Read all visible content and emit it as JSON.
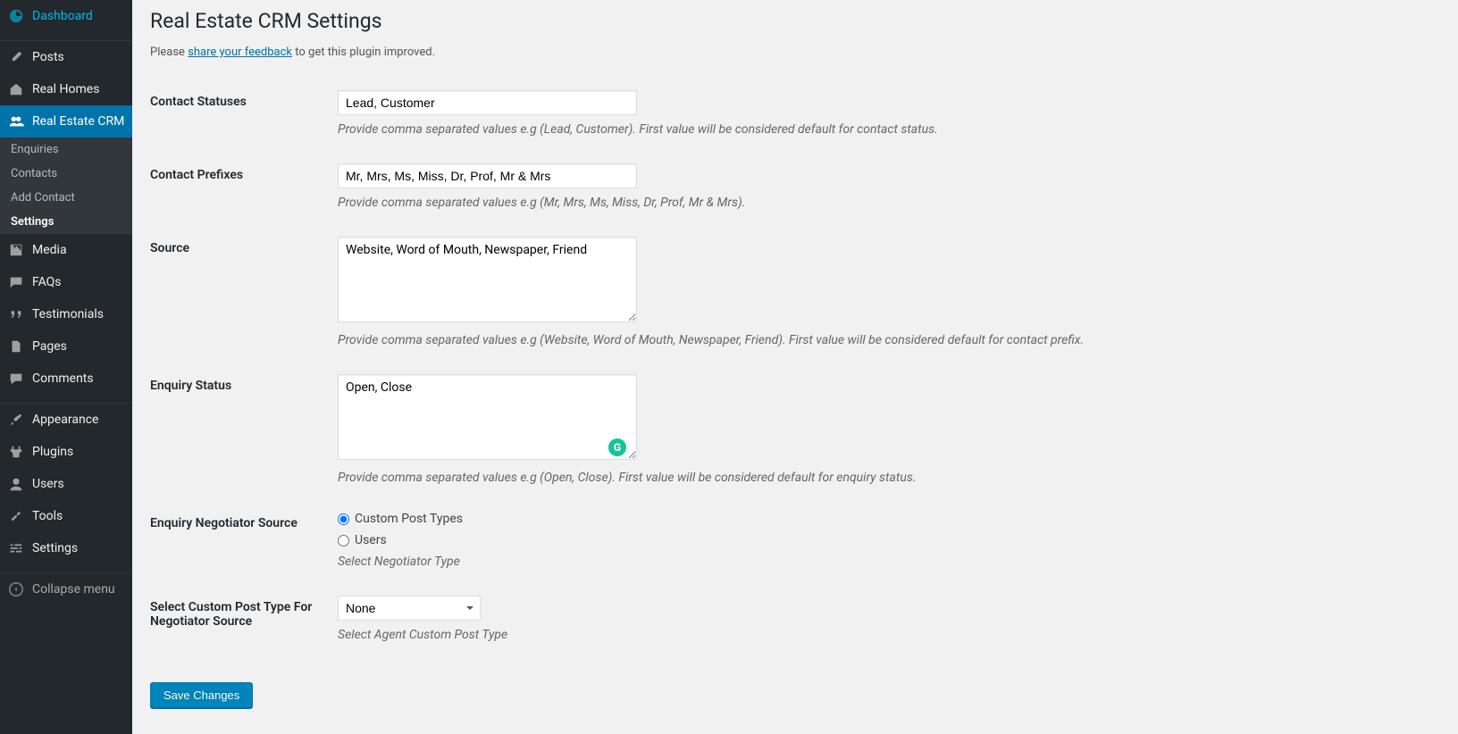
{
  "sidebar": {
    "items": [
      {
        "label": "Dashboard",
        "icon": "dashboard"
      },
      {
        "label": "Posts",
        "icon": "pin"
      },
      {
        "label": "Real Homes",
        "icon": "home"
      },
      {
        "label": "Real Estate CRM",
        "icon": "people",
        "active": true
      },
      {
        "label": "Media",
        "icon": "media"
      },
      {
        "label": "FAQs",
        "icon": "chat"
      },
      {
        "label": "Testimonials",
        "icon": "quote"
      },
      {
        "label": "Pages",
        "icon": "page"
      },
      {
        "label": "Comments",
        "icon": "comment"
      },
      {
        "label": "Appearance",
        "icon": "brush"
      },
      {
        "label": "Plugins",
        "icon": "plug"
      },
      {
        "label": "Users",
        "icon": "user"
      },
      {
        "label": "Tools",
        "icon": "wrench"
      },
      {
        "label": "Settings",
        "icon": "sliders"
      },
      {
        "label": "Collapse menu",
        "icon": "collapse"
      }
    ],
    "submenu": [
      {
        "label": "Enquiries"
      },
      {
        "label": "Contacts"
      },
      {
        "label": "Add Contact"
      },
      {
        "label": "Settings",
        "active": true
      }
    ]
  },
  "page": {
    "title": "Real Estate CRM Settings",
    "feedback_prefix": "Please ",
    "feedback_link": "share your feedback",
    "feedback_suffix": " to get this plugin improved."
  },
  "fields": {
    "contact_statuses": {
      "label": "Contact Statuses",
      "value": "Lead, Customer",
      "description": "Provide comma separated values e.g (Lead, Customer). First value will be considered default for contact status."
    },
    "contact_prefixes": {
      "label": "Contact Prefixes",
      "value": "Mr, Mrs, Ms, Miss, Dr, Prof, Mr & Mrs",
      "description": "Provide comma separated values e.g (Mr, Mrs, Ms, Miss, Dr, Prof, Mr & Mrs)."
    },
    "source": {
      "label": "Source",
      "value": "Website, Word of Mouth, Newspaper, Friend",
      "description": "Provide comma separated values e.g (Website, Word of Mouth, Newspaper, Friend). First value will be considered default for contact prefix."
    },
    "enquiry_status": {
      "label": "Enquiry Status",
      "value": "Open, Close",
      "description": "Provide comma separated values e.g (Open, Close). First value will be considered default for enquiry status."
    },
    "negotiator_source": {
      "label": "Enquiry Negotiator Source",
      "option1": "Custom Post Types",
      "option2": "Users",
      "description": "Select Negotiator Type"
    },
    "custom_post_type": {
      "label": "Select Custom Post Type For Negotiator Source",
      "value": "None",
      "description": "Select Agent Custom Post Type"
    }
  },
  "buttons": {
    "save": "Save Changes"
  }
}
